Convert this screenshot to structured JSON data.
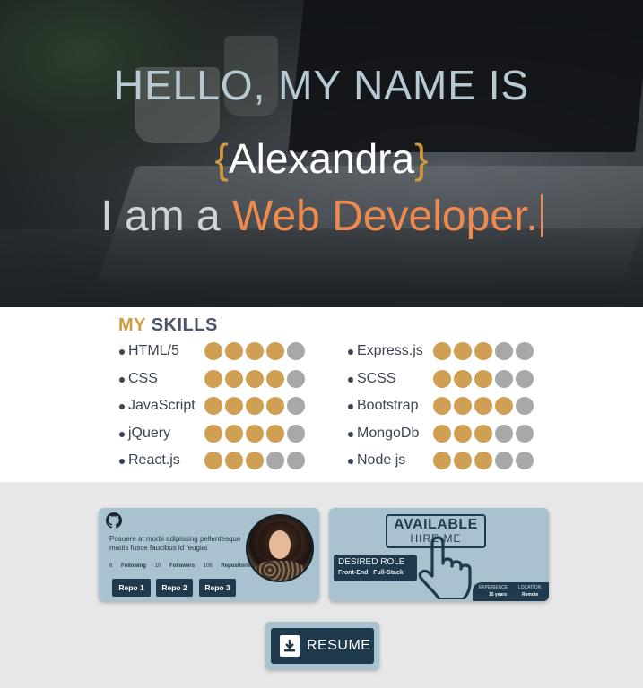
{
  "hero": {
    "greeting": "HELLO, MY NAME IS",
    "brace_open": "{",
    "name": "Alexandra",
    "brace_close": "}",
    "intro": "I am a ",
    "role": "Web Developer."
  },
  "skills": {
    "title_my": "MY",
    "title_skills": "SKILLS",
    "left": [
      {
        "name": "HTML/5",
        "level": 4,
        "max": 5
      },
      {
        "name": "CSS",
        "level": 4,
        "max": 5
      },
      {
        "name": "JavaScript",
        "level": 4,
        "max": 5
      },
      {
        "name": "jQuery",
        "level": 4,
        "max": 5
      },
      {
        "name": "React.js",
        "level": 3,
        "max": 5
      }
    ],
    "right": [
      {
        "name": "Express.js",
        "level": 3,
        "max": 5
      },
      {
        "name": "SCSS",
        "level": 3,
        "max": 5
      },
      {
        "name": "Bootstrap",
        "level": 4,
        "max": 5
      },
      {
        "name": "MongoDb",
        "level": 3,
        "max": 5
      },
      {
        "name": "Node js",
        "level": 3,
        "max": 5
      }
    ]
  },
  "github": {
    "icon": "github-icon",
    "bio": "Posuere at morbi adipiscing pellentesque mattis fusce faucibus id feugiat",
    "following_count": "6",
    "following_label": "Following",
    "followers_count": "10",
    "followers_label": "Followers",
    "repos_count": "106",
    "repos_label": "Repositories",
    "repos": [
      "Repo 1",
      "Repo 2",
      "Repo 3"
    ]
  },
  "hire": {
    "available": "AVAILABLE",
    "hire_me": "HIRE ME",
    "desired_role_label": "DESIRED ROLE",
    "role_1": "Front-End",
    "role_2": "Full-Stack",
    "experience_label": "EXPERIENCE",
    "experience_value": "15 years",
    "location_label": "LOCATION",
    "location_value": "Remote"
  },
  "resume": {
    "label": "RESUME",
    "icon": "download-file-icon"
  },
  "colors": {
    "accent_gold": "#cf9f54",
    "accent_orange": "#ef8a4c",
    "navy": "#1f3a4d",
    "card_blue": "#a9c2cf",
    "dot_off": "#a8a8a8"
  }
}
